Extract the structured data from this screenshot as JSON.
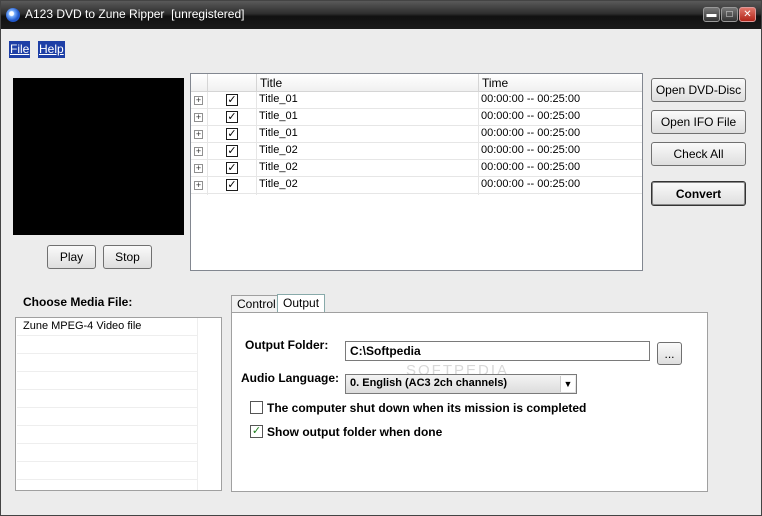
{
  "window": {
    "title": "A123 DVD to Zune Ripper  [unregistered]",
    "controls": {
      "minimize": "▬",
      "maximize": "□",
      "close": "✕"
    }
  },
  "menu": {
    "file": "File",
    "help": "Help"
  },
  "player": {
    "play_label": "Play",
    "stop_label": "Stop"
  },
  "titles_table": {
    "headers": {
      "title": "Title",
      "time": "Time"
    },
    "rows": [
      {
        "title": "Title_01",
        "time": "00:00:00 -- 00:25:00",
        "checked": true
      },
      {
        "title": "Title_01",
        "time": "00:00:00 -- 00:25:00",
        "checked": true
      },
      {
        "title": "Title_01",
        "time": "00:00:00 -- 00:25:00",
        "checked": true
      },
      {
        "title": "Title_02",
        "time": "00:00:00 -- 00:25:00",
        "checked": true
      },
      {
        "title": "Title_02",
        "time": "00:00:00 -- 00:25:00",
        "checked": true
      },
      {
        "title": "Title_02",
        "time": "00:00:00 -- 00:25:00",
        "checked": true
      }
    ]
  },
  "actions": {
    "open_dvd": "Open DVD-Disc",
    "open_ifo": "Open IFO File",
    "check_all": "Check All",
    "convert": "Convert"
  },
  "media": {
    "heading": "Choose Media File:",
    "items": [
      "Zune MPEG-4 Video file"
    ]
  },
  "tabs": {
    "control": "Control",
    "output": "Output"
  },
  "output": {
    "folder_label": "Output Folder:",
    "folder_value": "C:\\Softpedia",
    "browse_label": "...",
    "audio_label": "Audio Language:",
    "audio_value": "0. English (AC3 2ch channels)",
    "shutdown_label": "The computer shut down when its mission is completed",
    "shutdown_checked": false,
    "show_folder_label": "Show output folder when done",
    "show_folder_checked": true
  },
  "watermark": "SOFTPEDIA"
}
